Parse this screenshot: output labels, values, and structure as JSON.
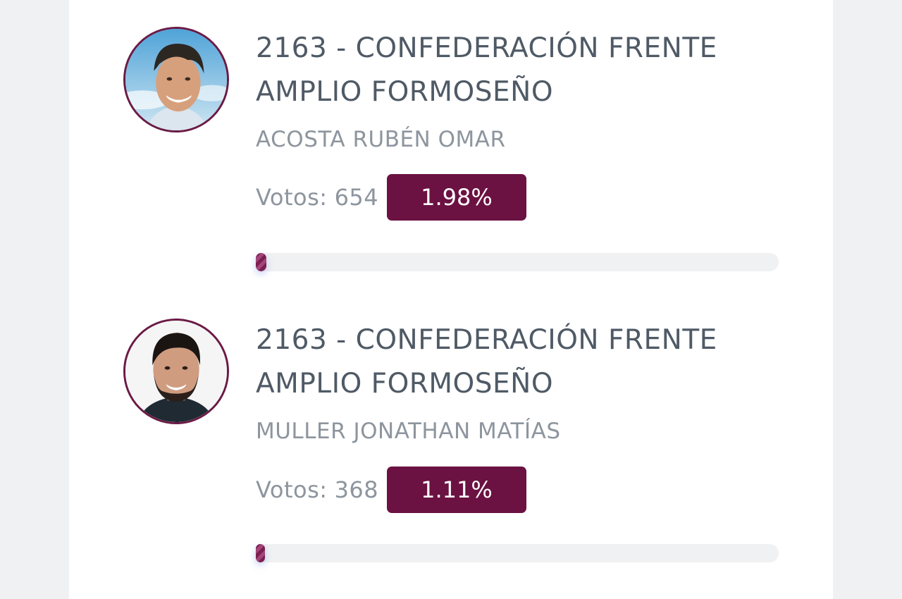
{
  "candidates": [
    {
      "party": "2163 - CONFEDERACIÓN FRENTE AMPLIO FORMOSEÑO",
      "name": "ACOSTA RUBÉN OMAR",
      "votes_label": "Votos:",
      "votes": "654",
      "percentage": "1.98%",
      "percentage_value": 1.98,
      "photo_icon": "candidate-photo"
    },
    {
      "party": "2163 - CONFEDERACIÓN FRENTE AMPLIO FORMOSEÑO",
      "name": "MULLER JONATHAN MATÍAS",
      "votes_label": "Votos:",
      "votes": "368",
      "percentage": "1.11%",
      "percentage_value": 1.11,
      "photo_icon": "candidate-photo"
    }
  ],
  "colors": {
    "accent": "#6b1242",
    "text_dark": "#4f5a66",
    "text_muted": "#8d959e",
    "track": "#f0f1f2"
  }
}
